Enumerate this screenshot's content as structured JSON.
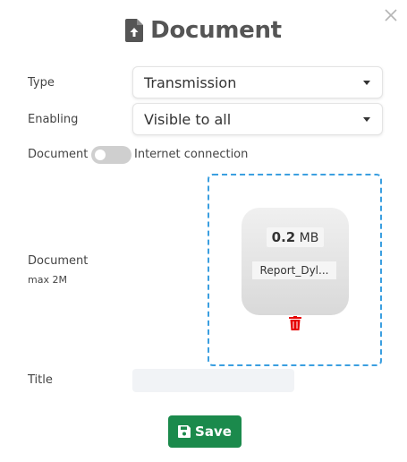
{
  "header": {
    "title": "Document",
    "icon": "file-upload-icon"
  },
  "close": {
    "icon": "close-icon"
  },
  "form": {
    "type_label": "Type",
    "type_value": "Transmission",
    "enabling_label": "Enabling",
    "enabling_value": "Visible to all",
    "document_toggle_label": "Document",
    "toggle_option_label": "Internet connection",
    "toggle_on": false,
    "document_label": "Document",
    "document_hint": "max 2M",
    "title_label": "Title",
    "title_value": ""
  },
  "upload": {
    "file_size_value": "0.2",
    "file_size_unit": "MB",
    "file_name": "Report_Dyl...",
    "delete_icon": "trash-icon"
  },
  "actions": {
    "save_label": "Save",
    "save_icon": "floppy-disk-icon"
  },
  "colors": {
    "primary_green": "#1b8a4c",
    "dropzone_border": "#3b9fe0",
    "delete_red": "#e60000",
    "title_text": "#555555"
  }
}
